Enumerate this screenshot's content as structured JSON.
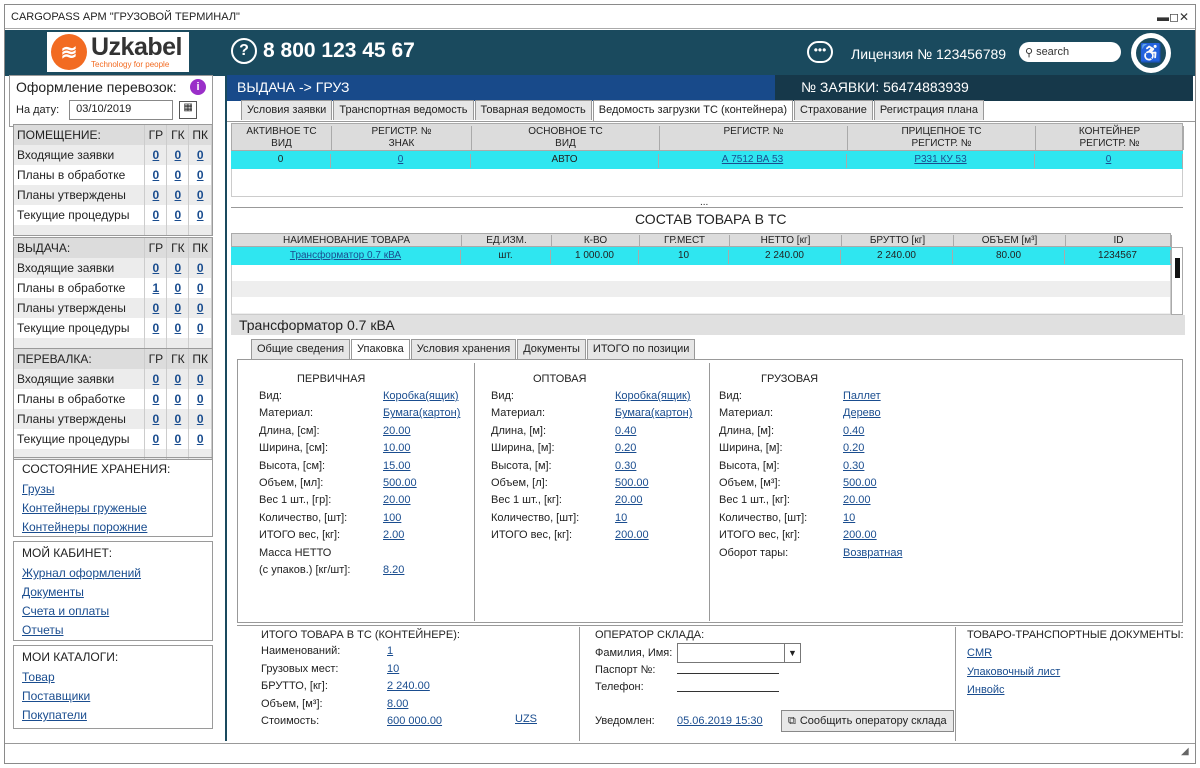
{
  "window": {
    "title": "CARGOPASS АРМ \"ГРУЗОВОЙ ТЕРМИНАЛ\"",
    "controls": "▬◻✕"
  },
  "header": {
    "logo_text": "Uzkabel",
    "logo_tagline": "Technology for people",
    "phone": "8 800 123 45 67",
    "license": "Лицензия № 123456789",
    "search_placeholder": "search"
  },
  "sidebar": {
    "title": "Оформление перевозок:",
    "date_label": "На дату:",
    "date_value": "03/10/2019",
    "groups": [
      {
        "title": "ПОМЕЩЕНИЕ:",
        "cols": [
          "ГР",
          "ГК",
          "ПК"
        ],
        "rows": [
          [
            "Входящие заявки",
            "0",
            "0",
            "0"
          ],
          [
            "Планы в обработке",
            "0",
            "0",
            "0"
          ],
          [
            "Планы утверждены",
            "0",
            "0",
            "0"
          ],
          [
            "Текущие процедуры",
            "0",
            "0",
            "0"
          ]
        ]
      },
      {
        "title": "ВЫДАЧА:",
        "cols": [
          "ГР",
          "ГК",
          "ПК"
        ],
        "rows": [
          [
            "Входящие заявки",
            "0",
            "0",
            "0"
          ],
          [
            "Планы в обработке",
            "1",
            "0",
            "0"
          ],
          [
            "Планы утверждены",
            "0",
            "0",
            "0"
          ],
          [
            "Текущие процедуры",
            "0",
            "0",
            "0"
          ]
        ]
      },
      {
        "title": "ПЕРЕВАЛКА:",
        "cols": [
          "ГР",
          "ГК",
          "ПК"
        ],
        "rows": [
          [
            "Входящие заявки",
            "0",
            "0",
            "0"
          ],
          [
            "Планы в обработке",
            "0",
            "0",
            "0"
          ],
          [
            "Планы утверждены",
            "0",
            "0",
            "0"
          ],
          [
            "Текущие процедуры",
            "0",
            "0",
            "0"
          ]
        ]
      }
    ],
    "storage": {
      "title": "СОСТОЯНИЕ ХРАНЕНИЯ:",
      "links": [
        "Грузы",
        "Контейнеры груженые",
        "Контейнеры порожние"
      ]
    },
    "cabinet": {
      "title": "МОЙ КАБИНЕТ:",
      "links": [
        "Журнал оформлений",
        "Документы",
        "Счета и оплаты",
        "Отчеты"
      ]
    },
    "catalogs": {
      "title": "МОИ КАТАЛОГИ:",
      "links": [
        "Товар",
        "Поставщики",
        "Покупатели"
      ]
    }
  },
  "main": {
    "breadcrumb": "ВЫДАЧА -> ГРУЗ",
    "order": "№ ЗАЯВКИ: 56474883939",
    "tabs": [
      "Условия заявки",
      "Транспортная ведомость",
      "Товарная ведомость",
      "Ведомость загрузки ТС (контейнера)",
      "Страхование",
      "Регистрация плана"
    ],
    "vehicle_headers": [
      [
        "АКТИВНОЕ ТС",
        "ВИД"
      ],
      [
        "РЕГИСТР. №",
        "ЗНАК"
      ],
      [
        "ОСНОВНОЕ ТС",
        "ВИД"
      ],
      [
        "",
        "РЕГИСТР. №"
      ],
      [
        "ПРИЦЕПНОЕ ТС",
        "РЕГИСТР. №"
      ],
      [
        "КОНТЕЙНЕР",
        "РЕГИСТР. №"
      ]
    ],
    "vehicle_row": [
      "0",
      "0",
      "АВТО",
      "А 7512 ВА 53",
      "Р331 КУ 53",
      "0"
    ],
    "dots": "...",
    "goods_title": "СОСТАВ ТОВАРА В ТС",
    "goods_headers": [
      "НАИМЕНОВАНИЕ ТОВАРА",
      "ЕД.ИЗМ.",
      "К-ВО",
      "ГР.МЕСТ",
      "НЕТТО [кг]",
      "БРУТТО [кг]",
      "ОБЪЕМ [м³]",
      "ID"
    ],
    "goods_row": [
      "Трансформатор 0.7 кВА",
      "шт.",
      "1 000.00",
      "10",
      "2 240.00",
      "2 240.00",
      "80.00",
      "1234567"
    ],
    "item_title": "Трансформатор 0.7 кВА",
    "item_tabs": [
      "Общие сведения",
      "Упаковка",
      "Условия хранения",
      "Документы",
      "ИТОГО по позиции"
    ],
    "primary": {
      "title": "ПЕРВИЧНАЯ",
      "labels": [
        "Вид:",
        "Материал:",
        "Длина, [см]:",
        "Ширина, [см]:",
        "Высота, [см]:",
        "Объем, [мл]:",
        "Вес 1 шт., [гр]:",
        "Количество, [шт]:",
        "ИТОГО вес, [кг]:",
        "Масса НЕТТО",
        "(с упаков.) [кг/шт]:"
      ],
      "values": [
        "Коробка(ящик)",
        "Бумага(картон)",
        "20.00",
        "10.00",
        "15.00",
        "500.00",
        "20.00",
        "100",
        "2.00",
        "",
        "8.20"
      ]
    },
    "wholesale": {
      "title": "ОПТОВАЯ",
      "labels": [
        "Вид:",
        "Материал:",
        "Длина, [м]:",
        "Ширина, [м]:",
        "Высота, [м]:",
        "Объем, [л]:",
        "Вес 1 шт., [кг]:",
        "Количество, [шт]:",
        "ИТОГО вес, [кг]:"
      ],
      "values": [
        "Коробка(ящик)",
        "Бумага(картон)",
        "0.40",
        "0.20",
        "0.30",
        "500.00",
        "20.00",
        "10",
        "200.00"
      ]
    },
    "cargo": {
      "title": "ГРУЗОВАЯ",
      "labels": [
        "Вид:",
        "Материал:",
        "Длина, [м]:",
        "Ширина, [м]:",
        "Высота, [м]:",
        "Объем, [м³]:",
        "Вес 1 шт., [кг]:",
        "Количество, [шт]:",
        "ИТОГО вес, [кг]:",
        "Оборот тары:"
      ],
      "values": [
        "Паллет",
        "Дерево",
        "0.40",
        "0.20",
        "0.30",
        "500.00",
        "20.00",
        "10",
        "200.00",
        "Возвратная"
      ]
    },
    "totals": {
      "title": "ИТОГО ТОВАРА В ТС (КОНТЕЙНЕРЕ):",
      "labels": [
        "Наименований:",
        "Грузовых мест:",
        "БРУТТО, [кг]:",
        "Объем, [м³]:",
        "Стоимость:"
      ],
      "values": [
        "1",
        "10",
        "2 240.00",
        "8.00",
        "600 000.00"
      ],
      "currency": "UZS"
    },
    "operator": {
      "title": "ОПЕРАТОР СКЛАДА:",
      "name_label": "Фамилия, Имя:",
      "passport_label": "Паспорт №:",
      "phone_label": "Телефон:",
      "notified_label": "Уведомлен:",
      "notified_value": "05.06.2019 15:30",
      "button": "Сообщить оператору склада"
    },
    "docs": {
      "title": "ТОВАРО-ТРАНСПОРТНЫЕ ДОКУМЕНТЫ:",
      "links": [
        "CMR",
        "Упаковочный лист",
        "Инвойс"
      ]
    }
  }
}
